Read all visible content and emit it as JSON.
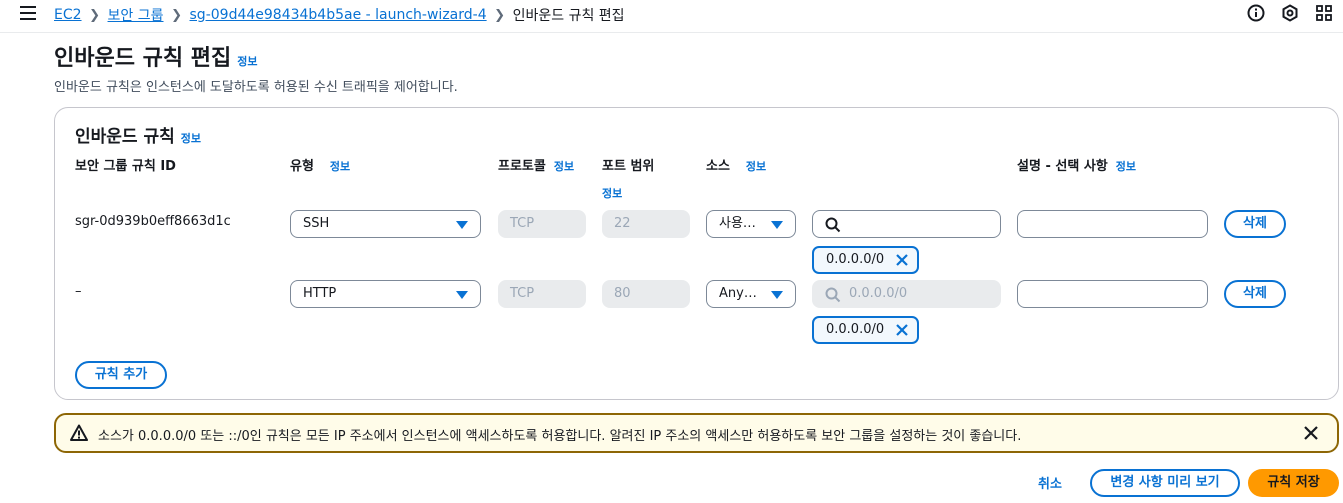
{
  "breadcrumb": {
    "items": [
      "EC2",
      "보안 그룹",
      "sg-09d44e98434b4b5ae - launch-wizard-4"
    ],
    "current": "인바운드 규칙 편집"
  },
  "header": {
    "title": "인바운드 규칙 편집",
    "info": "정보",
    "description": "인바운드 규칙은 인스턴스에 도달하도록 허용된 수신 트래픽을 제어합니다."
  },
  "rules_panel": {
    "title": "인바운드 규칙",
    "info": "정보",
    "columns": {
      "rule_id": "보안 그룹 규칙 ID",
      "type": "유형",
      "protocol": "프로토콜",
      "port_range": "포트 범위",
      "source": "소스",
      "description": "설명 - 선택 사항",
      "info": "정보"
    },
    "rows": [
      {
        "rule_id": "sgr-0d939b0eff8663d1c",
        "type": "SSH",
        "protocol": "TCP",
        "port": "22",
        "source": "사용…",
        "search_value": "",
        "token": "0.0.0.0/0",
        "delete_label": "삭제"
      },
      {
        "rule_id": "–",
        "type": "HTTP",
        "protocol": "TCP",
        "port": "80",
        "source": "Any…",
        "search_value": "0.0.0.0/0",
        "token": "0.0.0.0/0",
        "delete_label": "삭제"
      }
    ],
    "add_rule_label": "규칙 추가"
  },
  "alert": {
    "message": "소스가 0.0.0.0/0 또는 ::/0인 규칙은 모든 IP 주소에서 인스턴스에 액세스하도록 허용합니다. 알려진 IP 주소의 액세스만 허용하도록 보안 그룹을 설정하는 것이 좋습니다."
  },
  "footer": {
    "cancel_label": "취소",
    "preview_label": "변경 사항 미리 보기",
    "save_label": "규칙 저장"
  },
  "colors": {
    "link": "#0972d3",
    "primary": "#ff9900",
    "warning_border": "#8d6605",
    "warning_bg": "#fffce9"
  },
  "icons": [
    "menu-icon",
    "info-circle-icon",
    "gear-hexagon-icon",
    "notifications-icon",
    "search-icon",
    "close-icon",
    "warning-icon",
    "caret-down-icon"
  ]
}
